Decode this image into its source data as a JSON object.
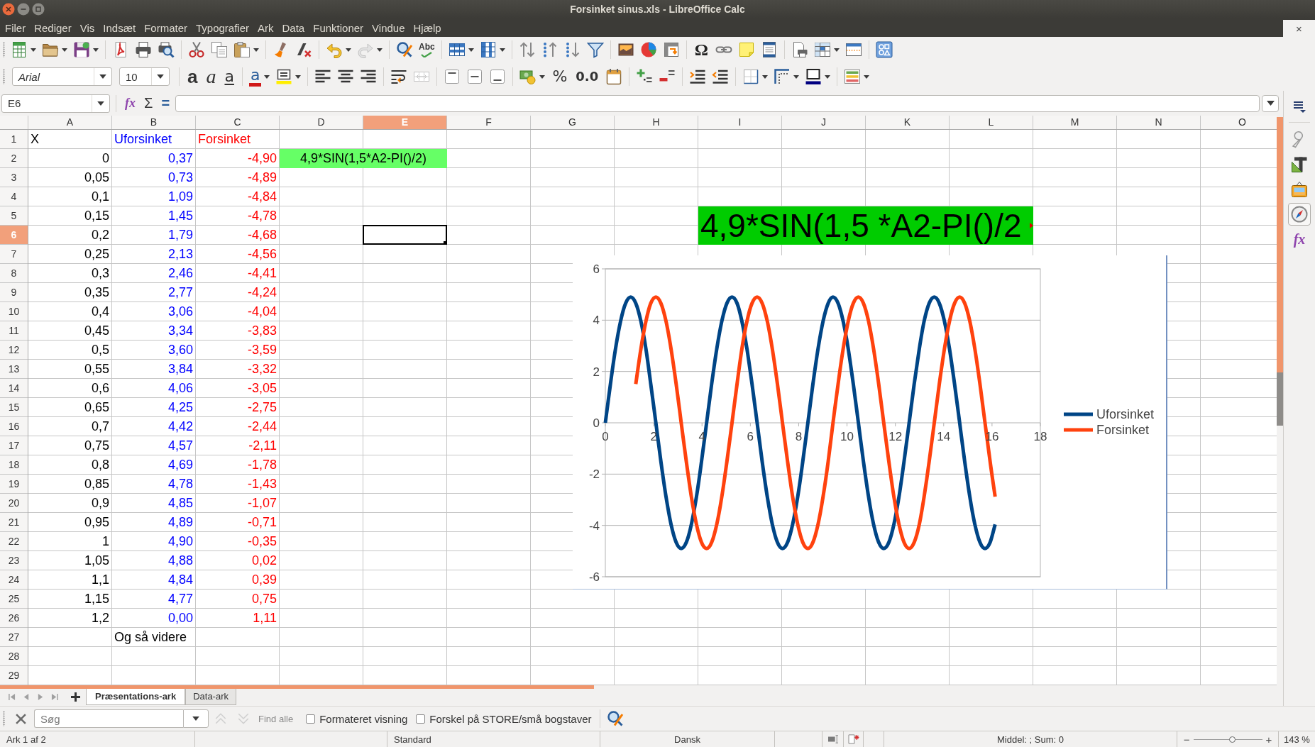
{
  "window": {
    "title": "Forsinket sinus.xls - LibreOffice Calc",
    "close_document": "×"
  },
  "menu": [
    "Filer",
    "Rediger",
    "Vis",
    "Indsæt",
    "Formater",
    "Typografier",
    "Ark",
    "Data",
    "Funktioner",
    "Vindue",
    "Hjælp"
  ],
  "standard_toolbar": {
    "spelling": "Abc",
    "special_character": "Ω"
  },
  "formatting_toolbar": {
    "font_name": "Arial",
    "font_size": "10",
    "bold": "a",
    "italic": "a",
    "underline": "a",
    "font_color": "a",
    "percent": "%",
    "number_format": "0.0"
  },
  "formula_bar": {
    "name_box": "E6",
    "function_wizard": "fx",
    "sum": "Σ",
    "formula": "="
  },
  "sheet": {
    "columns": [
      {
        "label": "A",
        "selected": false
      },
      {
        "label": "B",
        "selected": false
      },
      {
        "label": "C",
        "selected": false
      },
      {
        "label": "D",
        "selected": false
      },
      {
        "label": "E",
        "selected": true
      },
      {
        "label": "F",
        "selected": false
      },
      {
        "label": "G",
        "selected": false
      },
      {
        "label": "H",
        "selected": false
      },
      {
        "label": "I",
        "selected": false
      },
      {
        "label": "J",
        "selected": false
      },
      {
        "label": "K",
        "selected": false
      },
      {
        "label": "L",
        "selected": false
      },
      {
        "label": "M",
        "selected": false
      },
      {
        "label": "N",
        "selected": false
      },
      {
        "label": "O",
        "selected": false
      }
    ],
    "rows": [
      {
        "label": "1",
        "selected": false,
        "cells": [
          {
            "text": "X",
            "kind": "text",
            "color": "#000000"
          },
          {
            "text": "Uforsinket",
            "kind": "text",
            "color": "#0000ff"
          },
          {
            "text": "Forsinket",
            "kind": "text",
            "color": "#ff0000"
          }
        ]
      },
      {
        "label": "2",
        "selected": false,
        "cells": [
          {
            "text": "0",
            "kind": "number",
            "color": "#000000"
          },
          {
            "text": "0,37",
            "kind": "number",
            "color": "#0000ff"
          },
          {
            "text": "-4,90",
            "kind": "number",
            "color": "#ff0000"
          },
          {
            "text": "4,9*SIN(1,5*A2-PI()/2)",
            "kind": "highlight"
          }
        ]
      },
      {
        "label": "3",
        "selected": false,
        "cells": [
          {
            "text": "0,05",
            "kind": "number",
            "color": "#000000"
          },
          {
            "text": "0,73",
            "kind": "number",
            "color": "#0000ff"
          },
          {
            "text": "-4,89",
            "kind": "number",
            "color": "#ff0000"
          }
        ]
      },
      {
        "label": "4",
        "selected": false,
        "cells": [
          {
            "text": "0,1",
            "kind": "number",
            "color": "#000000"
          },
          {
            "text": "1,09",
            "kind": "number",
            "color": "#0000ff"
          },
          {
            "text": "-4,84",
            "kind": "number",
            "color": "#ff0000"
          }
        ]
      },
      {
        "label": "5",
        "selected": false,
        "cells": [
          {
            "text": "0,15",
            "kind": "number",
            "color": "#000000"
          },
          {
            "text": "1,45",
            "kind": "number",
            "color": "#0000ff"
          },
          {
            "text": "-4,78",
            "kind": "number",
            "color": "#ff0000"
          }
        ]
      },
      {
        "label": "6",
        "selected": true,
        "cells": [
          {
            "text": "0,2",
            "kind": "number",
            "color": "#000000"
          },
          {
            "text": "1,79",
            "kind": "number",
            "color": "#0000ff"
          },
          {
            "text": "-4,68",
            "kind": "number",
            "color": "#ff0000"
          }
        ]
      },
      {
        "label": "7",
        "selected": false,
        "cells": [
          {
            "text": "0,25",
            "kind": "number",
            "color": "#000000"
          },
          {
            "text": "2,13",
            "kind": "number",
            "color": "#0000ff"
          },
          {
            "text": "-4,56",
            "kind": "number",
            "color": "#ff0000"
          }
        ]
      },
      {
        "label": "8",
        "selected": false,
        "cells": [
          {
            "text": "0,3",
            "kind": "number",
            "color": "#000000"
          },
          {
            "text": "2,46",
            "kind": "number",
            "color": "#0000ff"
          },
          {
            "text": "-4,41",
            "kind": "number",
            "color": "#ff0000"
          }
        ]
      },
      {
        "label": "9",
        "selected": false,
        "cells": [
          {
            "text": "0,35",
            "kind": "number",
            "color": "#000000"
          },
          {
            "text": "2,77",
            "kind": "number",
            "color": "#0000ff"
          },
          {
            "text": "-4,24",
            "kind": "number",
            "color": "#ff0000"
          }
        ]
      },
      {
        "label": "10",
        "selected": false,
        "cells": [
          {
            "text": "0,4",
            "kind": "number",
            "color": "#000000"
          },
          {
            "text": "3,06",
            "kind": "number",
            "color": "#0000ff"
          },
          {
            "text": "-4,04",
            "kind": "number",
            "color": "#ff0000"
          }
        ]
      },
      {
        "label": "11",
        "selected": false,
        "cells": [
          {
            "text": "0,45",
            "kind": "number",
            "color": "#000000"
          },
          {
            "text": "3,34",
            "kind": "number",
            "color": "#0000ff"
          },
          {
            "text": "-3,83",
            "kind": "number",
            "color": "#ff0000"
          }
        ]
      },
      {
        "label": "12",
        "selected": false,
        "cells": [
          {
            "text": "0,5",
            "kind": "number",
            "color": "#000000"
          },
          {
            "text": "3,60",
            "kind": "number",
            "color": "#0000ff"
          },
          {
            "text": "-3,59",
            "kind": "number",
            "color": "#ff0000"
          }
        ]
      },
      {
        "label": "13",
        "selected": false,
        "cells": [
          {
            "text": "0,55",
            "kind": "number",
            "color": "#000000"
          },
          {
            "text": "3,84",
            "kind": "number",
            "color": "#0000ff"
          },
          {
            "text": "-3,32",
            "kind": "number",
            "color": "#ff0000"
          }
        ]
      },
      {
        "label": "14",
        "selected": false,
        "cells": [
          {
            "text": "0,6",
            "kind": "number",
            "color": "#000000"
          },
          {
            "text": "4,06",
            "kind": "number",
            "color": "#0000ff"
          },
          {
            "text": "-3,05",
            "kind": "number",
            "color": "#ff0000"
          }
        ]
      },
      {
        "label": "15",
        "selected": false,
        "cells": [
          {
            "text": "0,65",
            "kind": "number",
            "color": "#000000"
          },
          {
            "text": "4,25",
            "kind": "number",
            "color": "#0000ff"
          },
          {
            "text": "-2,75",
            "kind": "number",
            "color": "#ff0000"
          }
        ]
      },
      {
        "label": "16",
        "selected": false,
        "cells": [
          {
            "text": "0,7",
            "kind": "number",
            "color": "#000000"
          },
          {
            "text": "4,42",
            "kind": "number",
            "color": "#0000ff"
          },
          {
            "text": "-2,44",
            "kind": "number",
            "color": "#ff0000"
          }
        ]
      },
      {
        "label": "17",
        "selected": false,
        "cells": [
          {
            "text": "0,75",
            "kind": "number",
            "color": "#000000"
          },
          {
            "text": "4,57",
            "kind": "number",
            "color": "#0000ff"
          },
          {
            "text": "-2,11",
            "kind": "number",
            "color": "#ff0000"
          }
        ]
      },
      {
        "label": "18",
        "selected": false,
        "cells": [
          {
            "text": "0,8",
            "kind": "number",
            "color": "#000000"
          },
          {
            "text": "4,69",
            "kind": "number",
            "color": "#0000ff"
          },
          {
            "text": "-1,78",
            "kind": "number",
            "color": "#ff0000"
          }
        ]
      },
      {
        "label": "19",
        "selected": false,
        "cells": [
          {
            "text": "0,85",
            "kind": "number",
            "color": "#000000"
          },
          {
            "text": "4,78",
            "kind": "number",
            "color": "#0000ff"
          },
          {
            "text": "-1,43",
            "kind": "number",
            "color": "#ff0000"
          }
        ]
      },
      {
        "label": "20",
        "selected": false,
        "cells": [
          {
            "text": "0,9",
            "kind": "number",
            "color": "#000000"
          },
          {
            "text": "4,85",
            "kind": "number",
            "color": "#0000ff"
          },
          {
            "text": "-1,07",
            "kind": "number",
            "color": "#ff0000"
          }
        ]
      },
      {
        "label": "21",
        "selected": false,
        "cells": [
          {
            "text": "0,95",
            "kind": "number",
            "color": "#000000"
          },
          {
            "text": "4,89",
            "kind": "number",
            "color": "#0000ff"
          },
          {
            "text": "-0,71",
            "kind": "number",
            "color": "#ff0000"
          }
        ]
      },
      {
        "label": "22",
        "selected": false,
        "cells": [
          {
            "text": "1",
            "kind": "number",
            "color": "#000000"
          },
          {
            "text": "4,90",
            "kind": "number",
            "color": "#0000ff"
          },
          {
            "text": "-0,35",
            "kind": "number",
            "color": "#ff0000"
          }
        ]
      },
      {
        "label": "23",
        "selected": false,
        "cells": [
          {
            "text": "1,05",
            "kind": "number",
            "color": "#000000"
          },
          {
            "text": "4,88",
            "kind": "number",
            "color": "#0000ff"
          },
          {
            "text": "0,02",
            "kind": "number",
            "color": "#ff0000"
          }
        ]
      },
      {
        "label": "24",
        "selected": false,
        "cells": [
          {
            "text": "1,1",
            "kind": "number",
            "color": "#000000"
          },
          {
            "text": "4,84",
            "kind": "number",
            "color": "#0000ff"
          },
          {
            "text": "0,39",
            "kind": "number",
            "color": "#ff0000"
          }
        ]
      },
      {
        "label": "25",
        "selected": false,
        "cells": [
          {
            "text": "1,15",
            "kind": "number",
            "color": "#000000"
          },
          {
            "text": "4,77",
            "kind": "number",
            "color": "#0000ff"
          },
          {
            "text": "0,75",
            "kind": "number",
            "color": "#ff0000"
          }
        ]
      },
      {
        "label": "26",
        "selected": false,
        "cells": [
          {
            "text": "1,2",
            "kind": "number",
            "color": "#000000"
          },
          {
            "text": "0,00",
            "kind": "number",
            "color": "#0000ff"
          },
          {
            "text": "1,11",
            "kind": "number",
            "color": "#ff0000"
          }
        ]
      },
      {
        "label": "27",
        "selected": false,
        "cells": [
          null,
          {
            "text": "Og så videre",
            "kind": "text",
            "color": "#000000"
          }
        ]
      },
      {
        "label": "28",
        "selected": false
      },
      {
        "label": "29",
        "selected": false
      }
    ],
    "banner": {
      "text": "4,9*SIN(1,5 *A2-PI()/2"
    },
    "chart": {
      "chart_data": {
        "type": "line",
        "x": [
          0,
          0.21,
          0.42,
          0.63,
          0.84,
          1.05,
          1.26,
          1.47,
          1.68,
          1.88,
          2.09,
          2.3,
          2.51,
          2.72,
          2.93,
          3.14,
          3.35,
          3.56,
          3.77,
          3.98,
          4.19,
          4.4,
          4.61,
          4.82,
          5.03,
          5.24,
          5.45,
          5.65,
          5.86,
          6.07,
          6.28,
          6.49,
          6.7,
          6.91,
          7.12,
          7.33,
          7.54,
          7.75,
          7.96,
          8.17,
          8.38,
          8.59,
          8.8,
          9.01,
          9.22,
          9.42,
          9.63,
          9.84,
          10.05,
          10.26,
          10.47,
          10.68,
          10.89,
          11.1,
          11.31,
          11.52,
          11.73,
          11.94,
          12.15,
          12.36,
          12.57,
          12.78,
          12.99,
          13.19,
          13.4,
          13.61,
          13.82,
          14.03,
          14.24,
          14.45,
          14.66,
          14.87,
          15.08,
          15.29,
          15.5,
          15.71,
          15.92,
          16.13
        ],
        "series": [
          {
            "name": "Uforsinket",
            "color": "#004586",
            "values": [
              0,
              1.51,
              2.88,
              3.96,
              4.66,
              4.9,
              4.66,
              3.96,
              2.88,
              1.51,
              0,
              -1.51,
              -2.88,
              -3.96,
              -4.66,
              -4.9,
              -4.66,
              -3.96,
              -2.88,
              -1.51,
              0,
              1.51,
              2.88,
              3.96,
              4.66,
              4.9,
              4.66,
              3.96,
              2.88,
              1.51,
              0,
              -1.51,
              -2.88,
              -3.96,
              -4.66,
              -4.9,
              -4.66,
              -3.96,
              -2.88,
              -1.51,
              0,
              1.51,
              2.88,
              3.96,
              4.66,
              4.9,
              4.66,
              3.96,
              2.88,
              1.51,
              0,
              -1.51,
              -2.88,
              -3.96,
              -4.66,
              -4.9,
              -4.66,
              -3.96,
              -2.88,
              -1.51,
              0,
              1.51,
              2.88,
              3.96,
              4.66,
              4.9,
              4.66,
              3.96,
              2.88,
              1.51,
              0,
              -1.51,
              -2.88,
              -3.96,
              -4.66,
              -4.9,
              -4.66,
              -3.96
            ]
          },
          {
            "name": "Forsinket",
            "color": "#ff420e",
            "values": [
              null,
              null,
              null,
              null,
              null,
              null,
              1.51,
              2.88,
              3.96,
              4.66,
              4.9,
              4.66,
              3.96,
              2.88,
              1.51,
              0,
              -1.51,
              -2.88,
              -3.96,
              -4.66,
              -4.9,
              -4.66,
              -3.96,
              -2.88,
              -1.51,
              0,
              1.51,
              2.88,
              3.96,
              4.66,
              4.9,
              4.66,
              3.96,
              2.88,
              1.51,
              0,
              -1.51,
              -2.88,
              -3.96,
              -4.66,
              -4.9,
              -4.66,
              -3.96,
              -2.88,
              -1.51,
              0,
              1.51,
              2.88,
              3.96,
              4.66,
              4.9,
              4.66,
              3.96,
              2.88,
              1.51,
              0,
              -1.51,
              -2.88,
              -3.96,
              -4.66,
              -4.9,
              -4.66,
              -3.96,
              -2.88,
              -1.51,
              0,
              1.51,
              2.88,
              3.96,
              4.66,
              4.9,
              4.66,
              3.96,
              2.88,
              1.51,
              0,
              -1.51,
              -2.88
            ]
          }
        ],
        "xlim": [
          0,
          18
        ],
        "ylim": [
          -6,
          6
        ],
        "xticks": [
          {
            "value": 0,
            "label": "0"
          },
          {
            "value": 2,
            "label": "2"
          },
          {
            "value": 4,
            "label": "4"
          },
          {
            "value": 6,
            "label": "6"
          },
          {
            "value": 8,
            "label": "8"
          },
          {
            "value": 10,
            "label": "10"
          },
          {
            "value": 12,
            "label": "12"
          },
          {
            "value": 14,
            "label": "14"
          },
          {
            "value": 16,
            "label": "16"
          },
          {
            "value": 18,
            "label": "18"
          }
        ],
        "yticks": [
          {
            "value": -6,
            "label": "-6"
          },
          {
            "value": -4,
            "label": "-4"
          },
          {
            "value": -2,
            "label": "-2"
          },
          {
            "value": 0,
            "label": "0"
          },
          {
            "value": 2,
            "label": "2"
          },
          {
            "value": 4,
            "label": "4"
          },
          {
            "value": 6,
            "label": "6"
          }
        ],
        "grid": true,
        "legend": true
      }
    }
  },
  "sheet_tabs": [
    {
      "label": "Præsentations-ark",
      "selected": true
    },
    {
      "label": "Data-ark",
      "selected": false
    }
  ],
  "sidebar": {
    "decks": [
      {
        "kind": "properties",
        "selected": false
      },
      {
        "kind": "styles",
        "selected": false
      },
      {
        "kind": "gallery",
        "selected": false
      },
      {
        "kind": "navigator",
        "selected": true
      },
      {
        "kind": "functions",
        "label": "fx",
        "selected": false
      }
    ]
  },
  "find_bar": {
    "placeholder": "Søg",
    "find_all": {
      "label": "Find alle",
      "disabled": true
    },
    "options": [
      {
        "label": "Formateret visning",
        "checked": false
      },
      {
        "label": "Forskel på STORE/små bogstaver",
        "checked": false
      }
    ]
  },
  "status_bar": {
    "sheet": "Ark 1 af 2",
    "page_style": "Standard",
    "language": "Dansk",
    "summary": "Middel: ; Sum: 0",
    "zoom_out": "−",
    "zoom_in": "+",
    "zoom_slider": {
      "level": 0.56
    },
    "zoom": "143 %"
  }
}
